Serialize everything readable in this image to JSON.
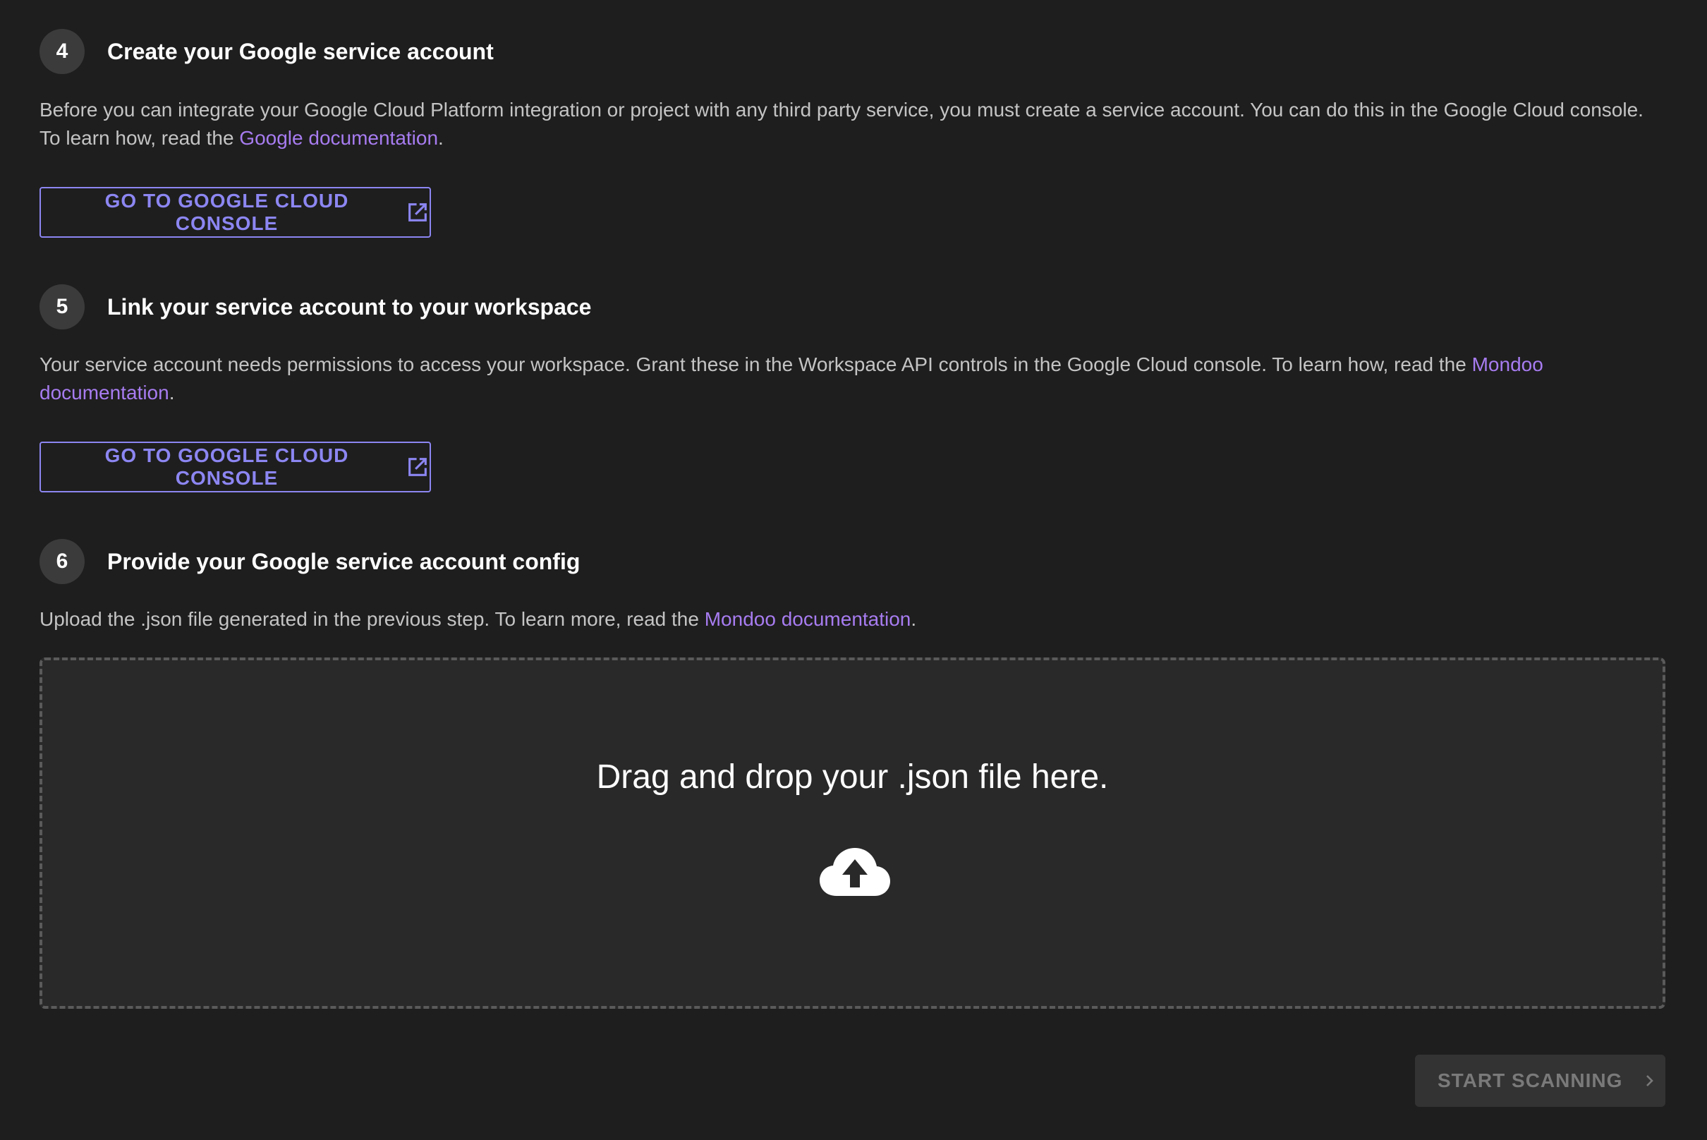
{
  "steps": [
    {
      "number": "4",
      "title": "Create your Google service account",
      "description_before_link": "Before you can integrate your Google Cloud Platform integration or project with any third party service, you must create a service account. You can do this in the Google Cloud console. To learn how, read the ",
      "link_text": "Google documentation",
      "description_after_link": ".",
      "button_label": "GO TO GOOGLE CLOUD CONSOLE",
      "button_icon": "external-link-icon"
    },
    {
      "number": "5",
      "title": "Link your service account to your workspace",
      "description_before_link": "Your service account needs permissions to access your workspace. Grant these in the Workspace API controls in the Google Cloud console. To learn how, read the ",
      "link_text": "Mondoo documentation",
      "description_after_link": ".",
      "button_label": "GO TO GOOGLE CLOUD CONSOLE",
      "button_icon": "external-link-icon"
    },
    {
      "number": "6",
      "title": "Provide your Google service account config",
      "description_before_link": "Upload the .json file generated in the previous step. To learn more, read the ",
      "link_text": "Mondoo documentation",
      "description_after_link": "."
    }
  ],
  "dropzone": {
    "text": "Drag and drop your .json file here.",
    "icon": "cloud-upload-icon"
  },
  "start_button": {
    "label": "START SCANNING",
    "icon": "chevron-right-icon",
    "disabled": true
  },
  "colors": {
    "background": "#1e1e1e",
    "accent": "#8c86f2",
    "link": "#a77cf0",
    "text_muted": "#c4c4c4"
  }
}
